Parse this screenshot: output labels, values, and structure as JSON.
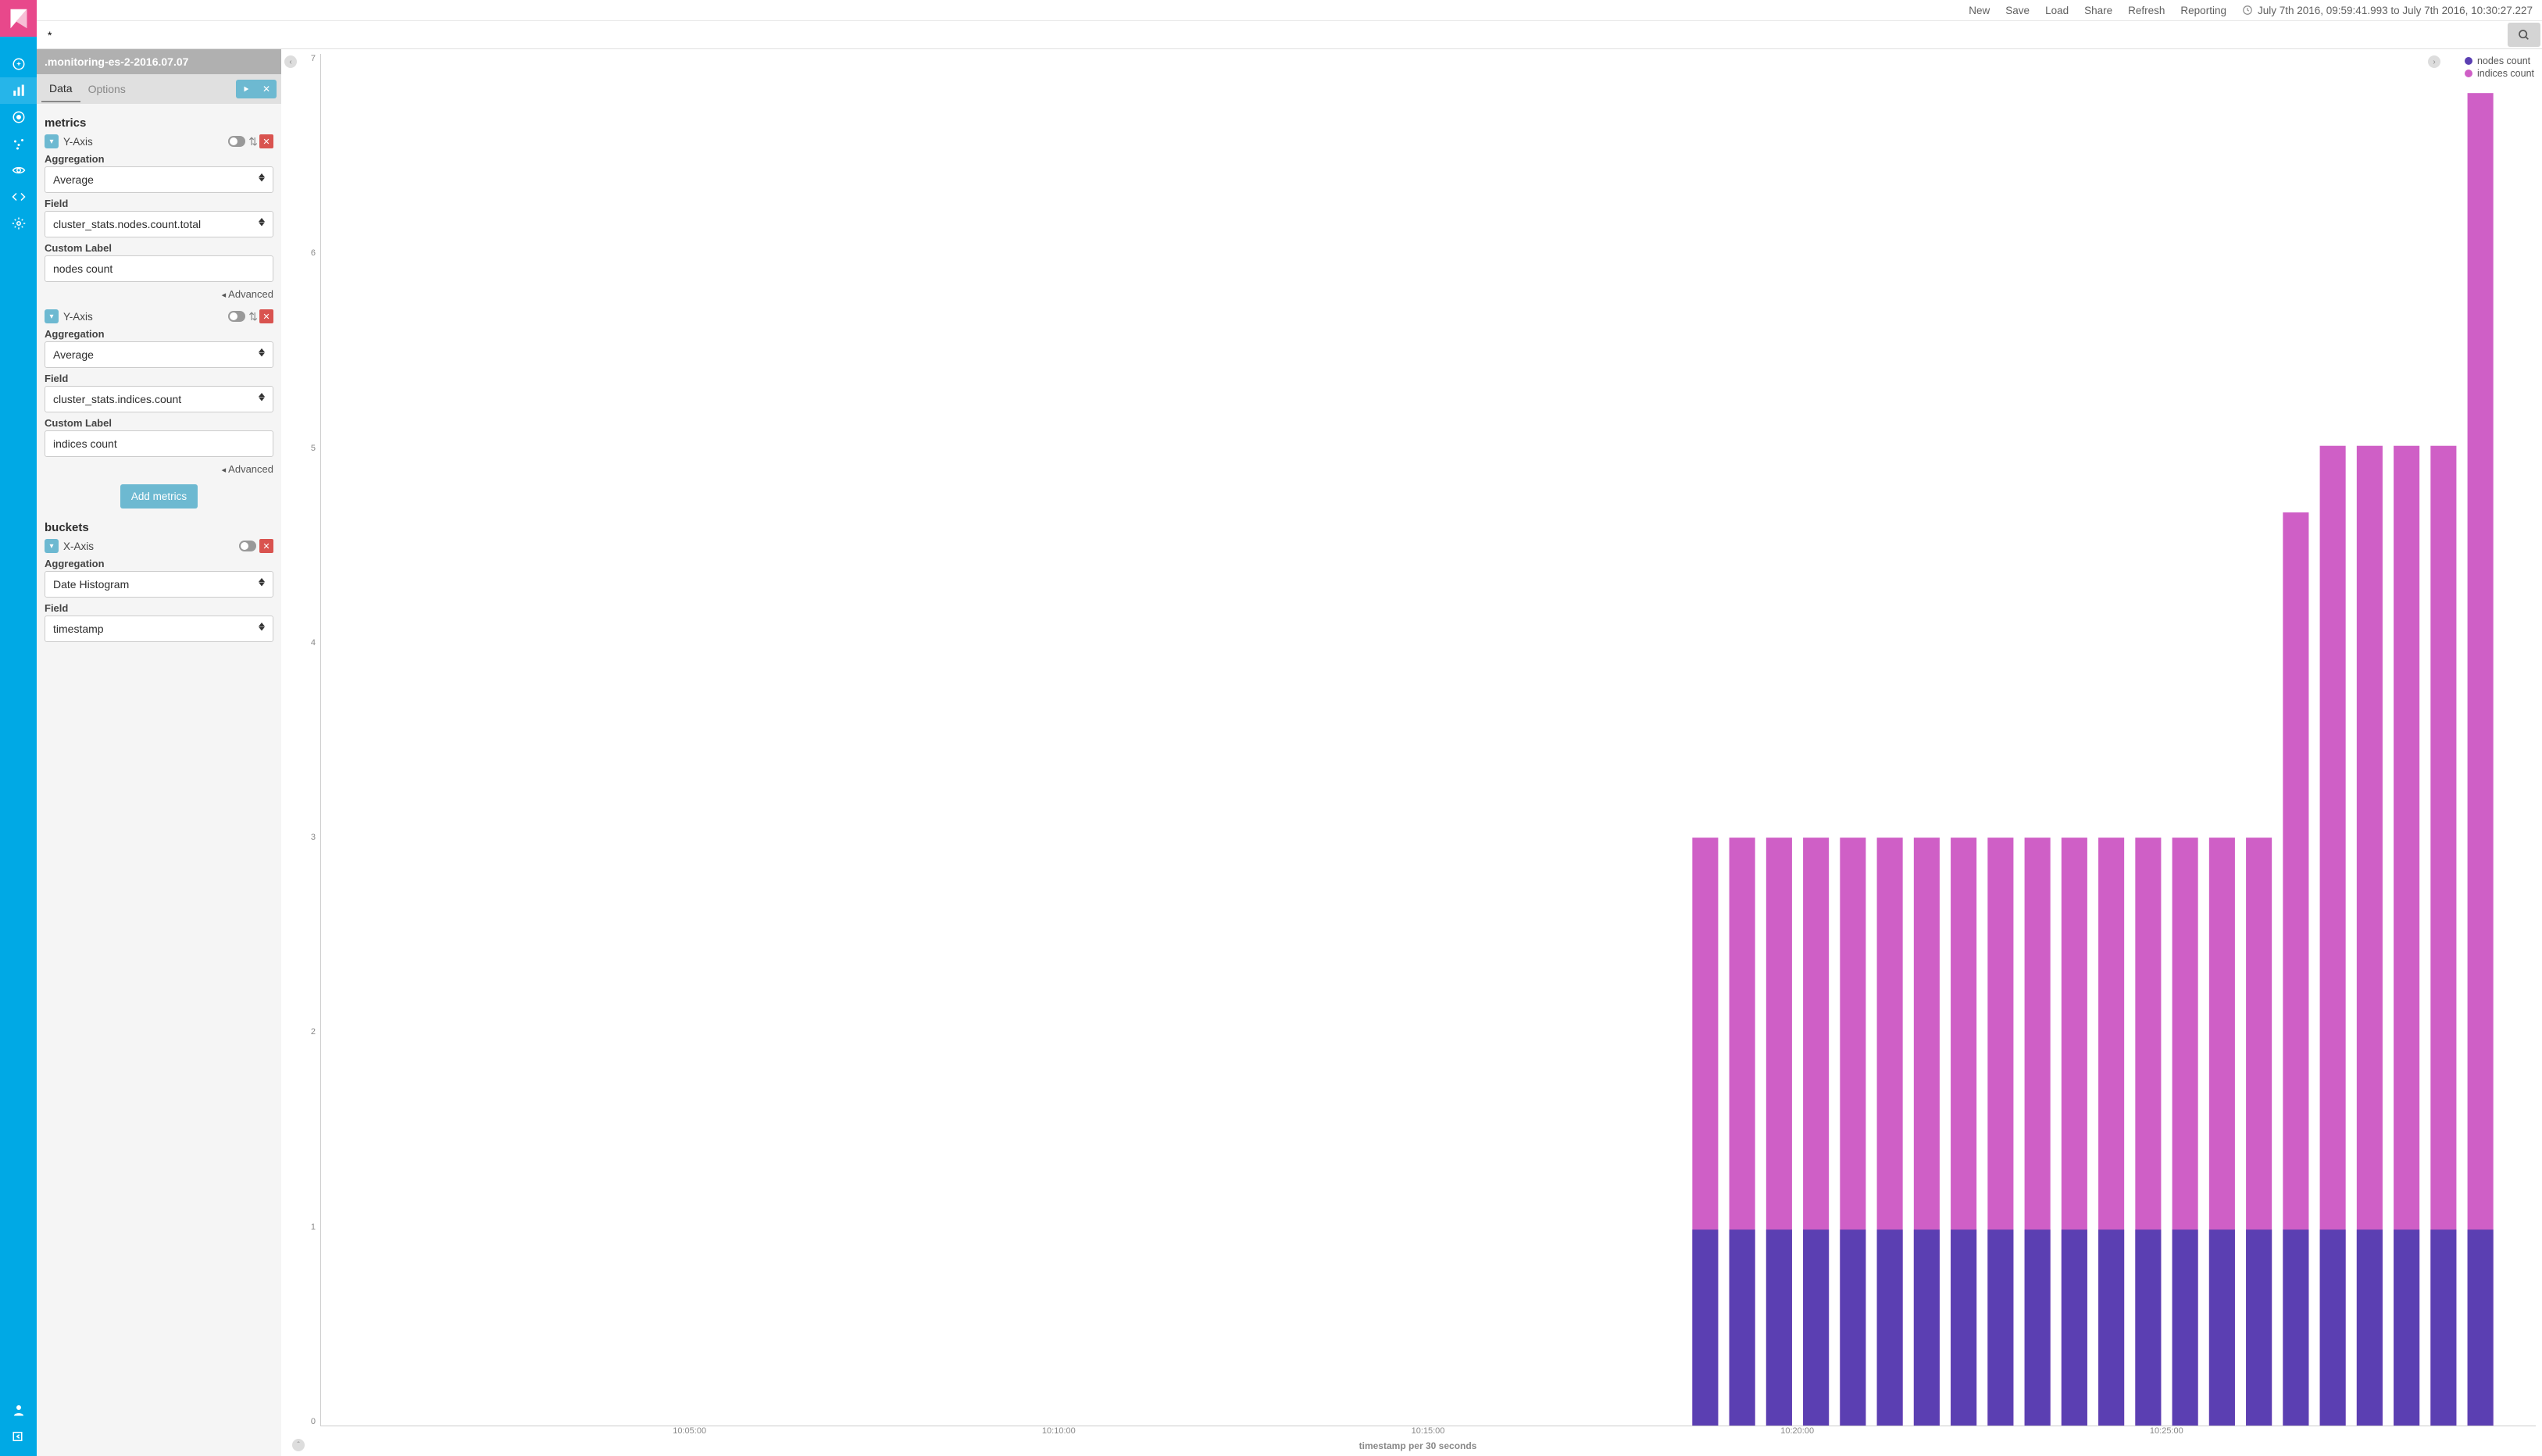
{
  "topbar": {
    "links": [
      "New",
      "Save",
      "Load",
      "Share",
      "Refresh",
      "Reporting"
    ],
    "time_range": "July 7th 2016, 09:59:41.993 to July 7th 2016, 10:30:27.227"
  },
  "query": {
    "value": "*"
  },
  "index_pattern": ".monitoring-es-2-2016.07.07",
  "tabs": {
    "data": "Data",
    "options": "Options"
  },
  "panel": {
    "metrics_title": "metrics",
    "buckets_title": "buckets",
    "yaxis_label": "Y-Axis",
    "xaxis_label": "X-Axis",
    "agg_label": "Aggregation",
    "field_label": "Field",
    "custom_label": "Custom Label",
    "advanced": "Advanced",
    "add_metrics": "Add metrics",
    "metric1": {
      "agg": "Average",
      "field": "cluster_stats.nodes.count.total",
      "custom": "nodes count"
    },
    "metric2": {
      "agg": "Average",
      "field": "cluster_stats.indices.count",
      "custom": "indices count"
    },
    "bucket": {
      "agg": "Date Histogram",
      "field": "timestamp"
    }
  },
  "legend": {
    "series1": {
      "label": "nodes count",
      "color": "#5b3fb2"
    },
    "series2": {
      "label": "indices count",
      "color": "#cf5fc6"
    }
  },
  "chart_data": {
    "type": "bar",
    "xlabel": "timestamp per 30 seconds",
    "ylabel": "",
    "ylim": [
      0,
      7
    ],
    "y_ticks": [
      0,
      1,
      2,
      3,
      4,
      5,
      6,
      7
    ],
    "x_ticks": [
      "10:05:00",
      "10:10:00",
      "10:15:00",
      "10:20:00",
      "10:25:00"
    ],
    "x_slots": 60,
    "x_start_slot": 37,
    "series": [
      {
        "name": "nodes count",
        "color": "#5b3fb2",
        "values": [
          1,
          1,
          1,
          1,
          1,
          1,
          1,
          1,
          1,
          1,
          1,
          1,
          1,
          1,
          1,
          1,
          1,
          1,
          1,
          1,
          1,
          1
        ]
      },
      {
        "name": "indices count",
        "color": "#cf5fc6",
        "values": [
          3,
          3,
          3,
          3,
          3,
          3,
          3,
          3,
          3,
          3,
          3,
          3,
          3,
          3,
          3,
          3,
          4.66,
          5,
          5,
          5,
          5,
          6.8
        ]
      }
    ]
  }
}
